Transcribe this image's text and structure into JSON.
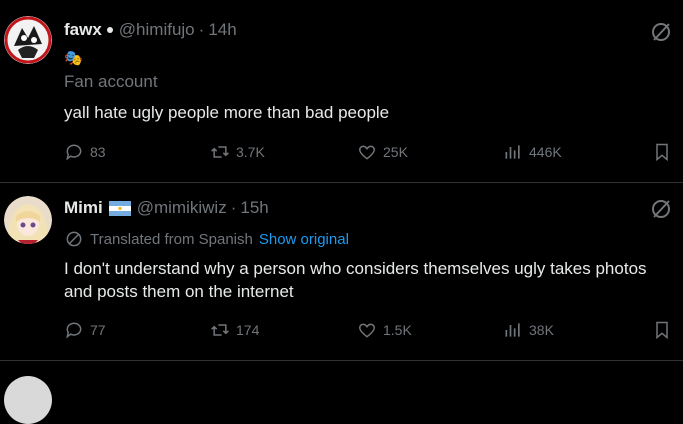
{
  "posts": [
    {
      "name": "fawx",
      "handle": "@himifujo",
      "sep": "·",
      "time": "14h",
      "badge_emoji": "🎭",
      "label": "Fan account",
      "text": "yall hate ugly people more than bad people",
      "stats": {
        "replies": "83",
        "reposts": "3.7K",
        "likes": "25K",
        "views": "446K"
      }
    },
    {
      "name": "Mimi",
      "handle": "@mimikiwiz",
      "sep": "·",
      "time": "15h",
      "translated_label": "Translated from Spanish",
      "show_original": "Show original",
      "text": "I don't understand why a person who considers themselves ugly takes photos and posts them on the internet",
      "stats": {
        "replies": "77",
        "reposts": "174",
        "likes": "1.5K",
        "views": "38K"
      }
    }
  ],
  "colors": {
    "background": "#000000",
    "text": "#e7e9ea",
    "muted": "#71767b",
    "link": "#1d9bf0",
    "divider": "#2f3336"
  },
  "icons": [
    "grok-icon",
    "reply-icon",
    "repost-icon",
    "like-icon",
    "views-icon",
    "bookmark-icon",
    "flag-argentina-icon",
    "translate-icon"
  ]
}
